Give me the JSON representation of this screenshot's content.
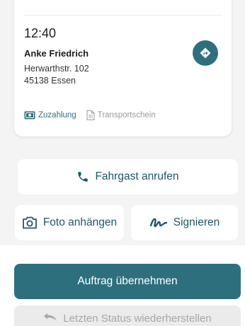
{
  "ride": {
    "time": "12:40",
    "passenger_name": "Anke Friedrich",
    "street": "Herwarthstr. 102",
    "city": "45138 Essen",
    "tags": {
      "copayment": "Zuzahlung",
      "transport_certificate": "Transportschein"
    }
  },
  "actions": {
    "call_passenger": "Fahrgast anrufen",
    "attach_photo": "Foto anhängen",
    "sign": "Signieren",
    "accept_order": "Auftrag übernehmen",
    "restore_status": "Letzten Status wiederherstellen"
  },
  "icons": {
    "navigate": "directions-icon",
    "copayment": "cash-icon",
    "transport_certificate": "document-icon",
    "call": "phone-icon",
    "photo": "camera-icon",
    "sign": "signature-icon",
    "restore": "undo-icon"
  },
  "colors": {
    "accent": "#2e6f7e",
    "accent_text": "#1f5766",
    "background": "#f4f4f4",
    "disabled_text": "#a7a7a7"
  }
}
